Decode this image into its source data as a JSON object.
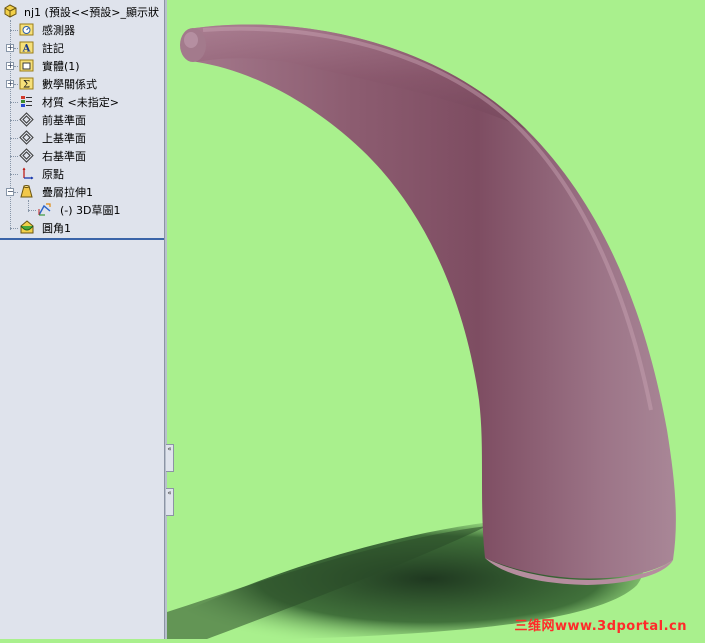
{
  "feature_tree": {
    "root": {
      "label": "nj1  (預設<<預設>_顯示狀",
      "icon": "part-icon"
    },
    "items": [
      {
        "label": "感測器",
        "icon": "sensor-folder-icon",
        "expandable": false
      },
      {
        "label": "註記",
        "icon": "annotation-folder-icon",
        "expandable": true
      },
      {
        "label": "實體(1)",
        "icon": "solid-bodies-folder-icon",
        "expandable": true
      },
      {
        "label": "數學關係式",
        "icon": "equations-folder-icon",
        "expandable": true
      },
      {
        "label": "材質 <未指定>",
        "icon": "material-icon",
        "expandable": false
      },
      {
        "label": "前基準面",
        "icon": "plane-icon",
        "expandable": false
      },
      {
        "label": "上基準面",
        "icon": "plane-icon",
        "expandable": false
      },
      {
        "label": "右基準面",
        "icon": "plane-icon",
        "expandable": false
      },
      {
        "label": "原點",
        "icon": "origin-icon",
        "expandable": false
      },
      {
        "label": "疊層拉伸1",
        "icon": "loft-icon",
        "expandable": true,
        "expanded": true
      },
      {
        "label": "(-) 3D草圖1",
        "icon": "3d-sketch-icon",
        "expandable": false
      },
      {
        "label": "圓角1",
        "icon": "fillet-icon",
        "expandable": false
      }
    ],
    "expand_symbol": "+",
    "collapse_symbol": "−"
  },
  "panel_grips": [
    "«",
    "«"
  ],
  "viewport": {
    "background": "#a9f08d",
    "model_color": "#9c6a80",
    "shadow_color": "#233a22"
  },
  "watermark": "三维网www.3dportal.cn"
}
